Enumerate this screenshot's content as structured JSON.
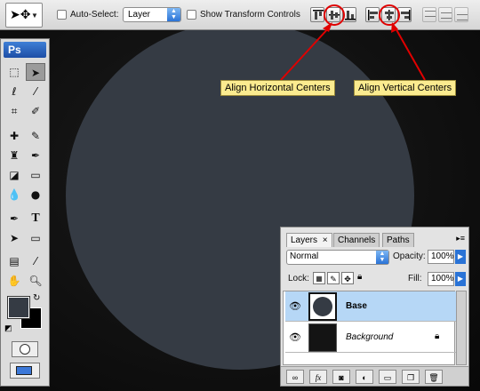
{
  "options_bar": {
    "tool_icon": "move-tool-icon",
    "auto_select_label": "Auto-Select:",
    "auto_select_value": "Layer",
    "show_transform_label": "Show Transform Controls"
  },
  "callouts": {
    "horizontal": "Align Horizontal Centers",
    "vertical": "Align Vertical Centers"
  },
  "toolbox": {
    "logo": "Ps"
  },
  "layers_panel": {
    "tabs": [
      "Layers",
      "Channels",
      "Paths"
    ],
    "tab_close": "×",
    "blend_mode": "Normal",
    "opacity_label": "Opacity:",
    "opacity_value": "100%",
    "lock_label": "Lock:",
    "fill_label": "Fill:",
    "fill_value": "100%",
    "layers": [
      {
        "name": "Base",
        "selected": true
      },
      {
        "name": "Background",
        "selected": false
      }
    ],
    "bottom_buttons": [
      "link",
      "fx",
      "mask",
      "adjustment",
      "group",
      "new",
      "delete"
    ]
  },
  "colors": {
    "canvas_circle": "#353b44",
    "canvas_bg": "#0e0e0e",
    "selection": "#b6d7f6",
    "callout": "#fbeb8f",
    "arrow": "#e00000"
  }
}
